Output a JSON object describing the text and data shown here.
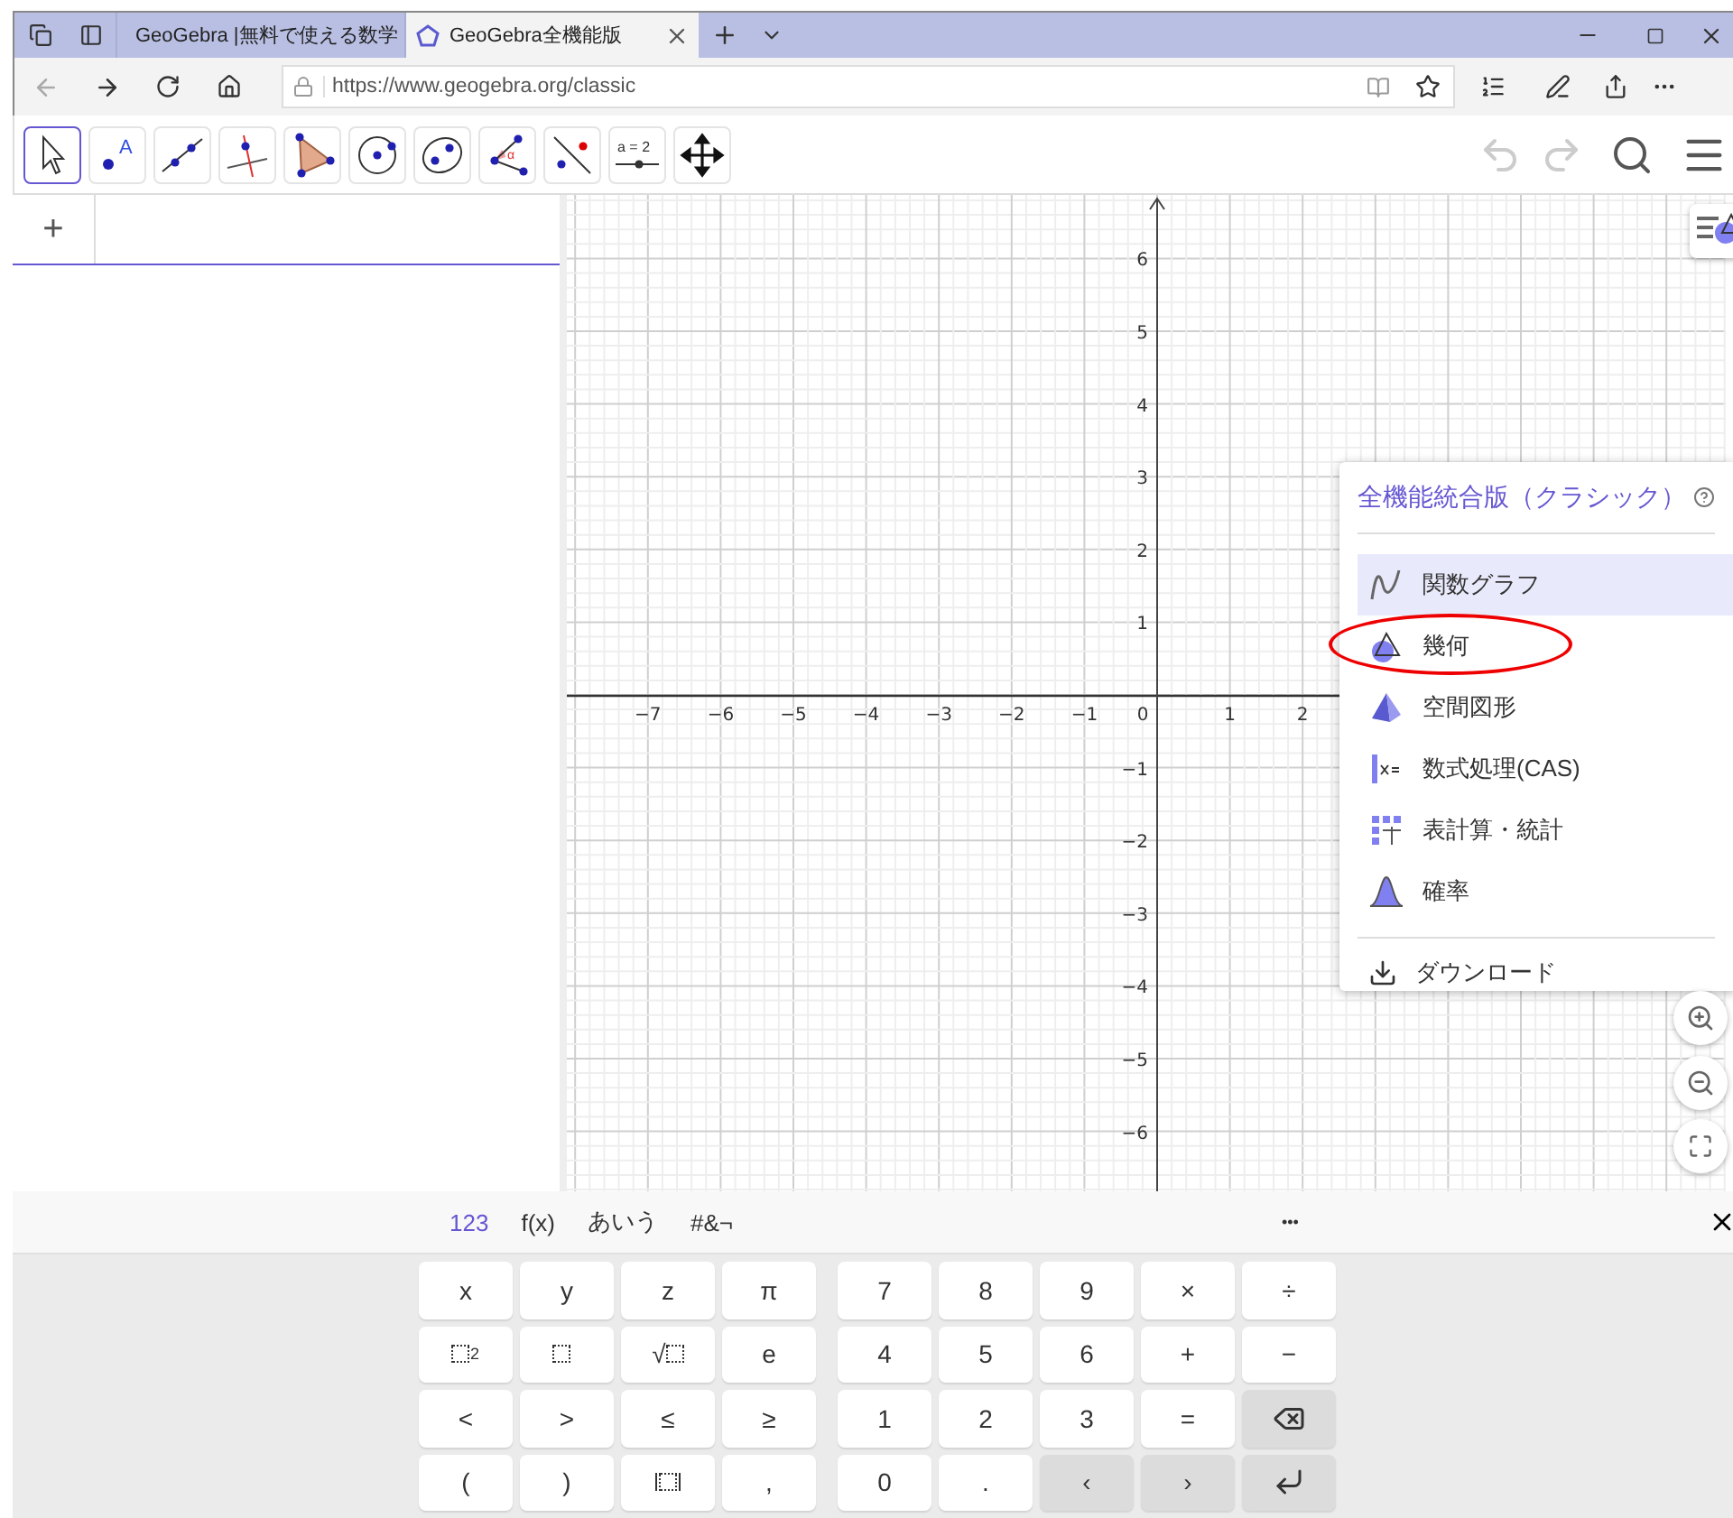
{
  "browser": {
    "tabs": [
      {
        "title": "GeoGebra |無料で使える数学",
        "selected": false
      },
      {
        "title": "GeoGebra全機能版",
        "selected": true
      }
    ],
    "url": "https://www.geogebra.org/classic"
  },
  "toolbar": {
    "tools": [
      {
        "kind": "move",
        "selected": true
      },
      {
        "kind": "point",
        "label": "A",
        "selected": false
      },
      {
        "kind": "line",
        "selected": false
      },
      {
        "kind": "perpendicular",
        "selected": false
      },
      {
        "kind": "polygon",
        "selected": false
      },
      {
        "kind": "circle",
        "selected": false
      },
      {
        "kind": "conic",
        "selected": false
      },
      {
        "kind": "angle",
        "label": "α",
        "selected": false
      },
      {
        "kind": "reflect",
        "selected": false
      },
      {
        "kind": "slider",
        "label": "a = 2",
        "selected": false
      },
      {
        "kind": "move_view",
        "selected": false
      }
    ],
    "history": [
      {
        "kind": "undo",
        "disabled": true
      },
      {
        "kind": "redo",
        "disabled": true
      }
    ]
  },
  "algebra": {
    "input_symbol": "+"
  },
  "graphics": {
    "x_labels": [
      "−7",
      "−6",
      "−5",
      "−4",
      "−3",
      "−2",
      "−1",
      "0",
      "1",
      "2"
    ],
    "y_labels": [
      "6",
      "5",
      "4",
      "3",
      "2",
      "1",
      "−1",
      "−2",
      "−3",
      "−4",
      "−5",
      "−6"
    ]
  },
  "app_menu": {
    "title": "全機能統合版（クラシック）",
    "items": [
      {
        "kind": "graphing",
        "label": "関数グラフ",
        "selected": true,
        "circled": false
      },
      {
        "kind": "geometry",
        "label": "幾何",
        "selected": false,
        "circled": true
      },
      {
        "kind": "solid",
        "label": "空間図形",
        "selected": false,
        "circled": false
      },
      {
        "kind": "cas",
        "label": "数式処理(CAS)",
        "selected": false,
        "circled": false
      },
      {
        "kind": "spreadsheet",
        "label": "表計算・統計",
        "selected": false,
        "circled": false
      },
      {
        "kind": "probability",
        "label": "確率",
        "selected": false,
        "circled": false
      }
    ],
    "download": "ダウンロード"
  },
  "keyboard": {
    "tabs": [
      {
        "label": "123",
        "selected": true
      },
      {
        "label": "f(x)",
        "selected": false
      },
      {
        "label": "あいう",
        "selected": false
      },
      {
        "label": "#&¬",
        "selected": false
      }
    ],
    "more": "•••",
    "left_keys": [
      {
        "kind": "text",
        "label": "x"
      },
      {
        "kind": "text",
        "label": "y"
      },
      {
        "kind": "text",
        "label": "z"
      },
      {
        "kind": "text",
        "label": "π"
      },
      {
        "kind": "power",
        "label": "2"
      },
      {
        "kind": "power"
      },
      {
        "kind": "sqrt",
        "label": "√"
      },
      {
        "kind": "text",
        "label": "e"
      },
      {
        "kind": "text",
        "label": "<"
      },
      {
        "kind": "text",
        "label": ">"
      },
      {
        "kind": "text",
        "label": "≤"
      },
      {
        "kind": "text",
        "label": "≥"
      },
      {
        "kind": "text",
        "label": "("
      },
      {
        "kind": "text",
        "label": ")"
      },
      {
        "kind": "abs"
      },
      {
        "kind": "text",
        "label": ","
      }
    ],
    "right_keys": [
      {
        "kind": "text",
        "label": "7"
      },
      {
        "kind": "text",
        "label": "8"
      },
      {
        "kind": "text",
        "label": "9"
      },
      {
        "kind": "text",
        "label": "×"
      },
      {
        "kind": "text",
        "label": "÷"
      },
      {
        "kind": "text",
        "label": "4"
      },
      {
        "kind": "text",
        "label": "5"
      },
      {
        "kind": "text",
        "label": "6"
      },
      {
        "kind": "text",
        "label": "+"
      },
      {
        "kind": "text",
        "label": "−"
      },
      {
        "kind": "text",
        "label": "1"
      },
      {
        "kind": "text",
        "label": "2"
      },
      {
        "kind": "text",
        "label": "3"
      },
      {
        "kind": "text",
        "label": "="
      },
      {
        "kind": "backspace"
      },
      {
        "kind": "text",
        "label": "0"
      },
      {
        "kind": "text",
        "label": "."
      },
      {
        "kind": "text",
        "label": "‹",
        "dark": true
      },
      {
        "kind": "text",
        "label": "›",
        "dark": true
      },
      {
        "kind": "enter"
      }
    ]
  }
}
